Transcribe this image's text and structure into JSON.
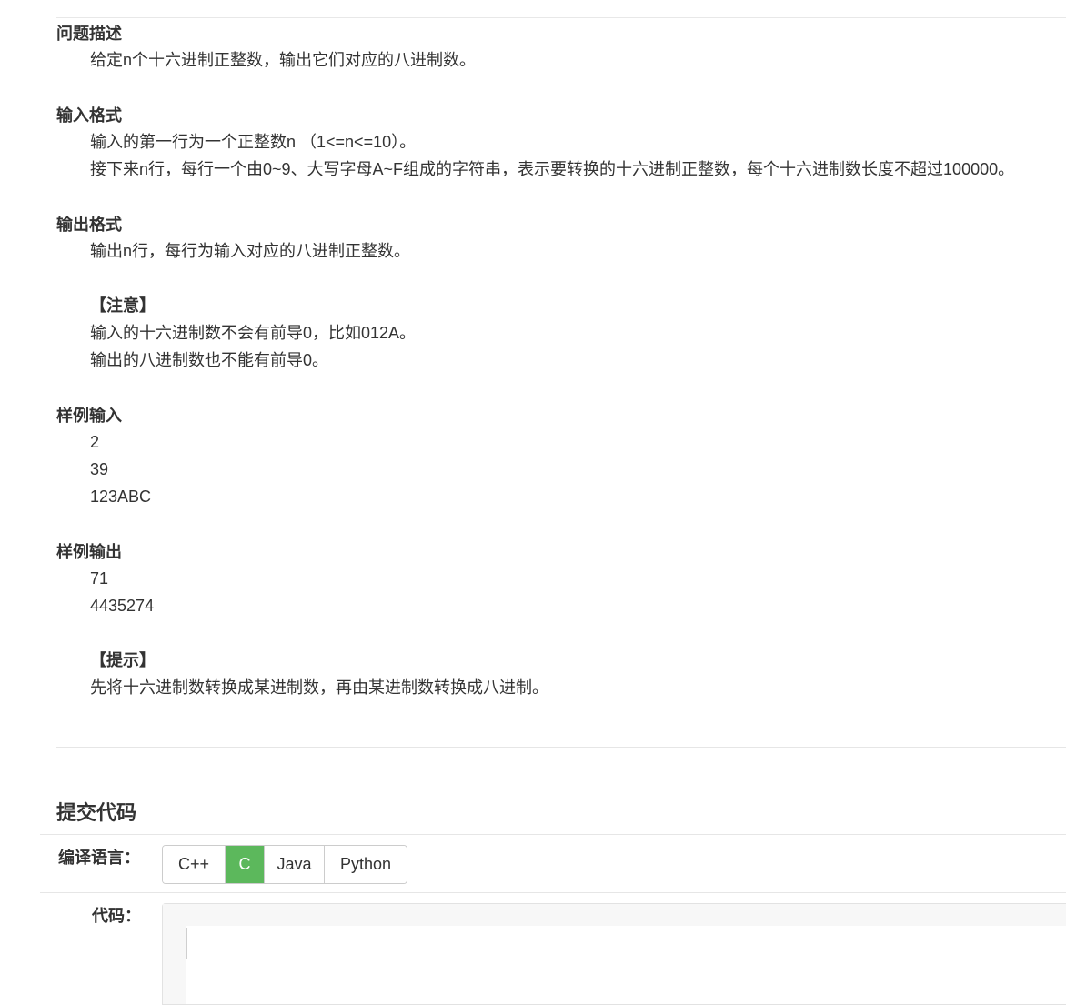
{
  "problem": {
    "description": {
      "title": "问题描述",
      "lines": [
        "给定n个十六进制正整数，输出它们对应的八进制数。"
      ]
    },
    "input_format": {
      "title": "输入格式",
      "lines": [
        "输入的第一行为一个正整数n （1<=n<=10）。",
        "接下来n行，每行一个由0~9、大写字母A~F组成的字符串，表示要转换的十六进制正整数，每个十六进制数长度不超过100000。"
      ]
    },
    "output_format": {
      "title": "输出格式",
      "lines": [
        "输出n行，每行为输入对应的八进制正整数。"
      ],
      "note_title": "【注意】",
      "note_lines": [
        "输入的十六进制数不会有前导0，比如012A。",
        "输出的八进制数也不能有前导0。"
      ]
    },
    "sample_input": {
      "title": "样例输入",
      "lines": [
        "2",
        "39",
        "123ABC"
      ]
    },
    "sample_output": {
      "title": "样例输出",
      "lines": [
        "71",
        "4435274"
      ],
      "hint_title": "【提示】",
      "hint_lines": [
        "先将十六进制数转换成某进制数，再由某进制数转换成八进制。"
      ]
    }
  },
  "submit": {
    "title": "提交代码",
    "language_label": "编译语言：",
    "languages": [
      "C++",
      "C",
      "Java",
      "Python"
    ],
    "selected_language": "C",
    "code_label": "代码：",
    "code_value": "",
    "accent_color": "#5cb85c"
  }
}
